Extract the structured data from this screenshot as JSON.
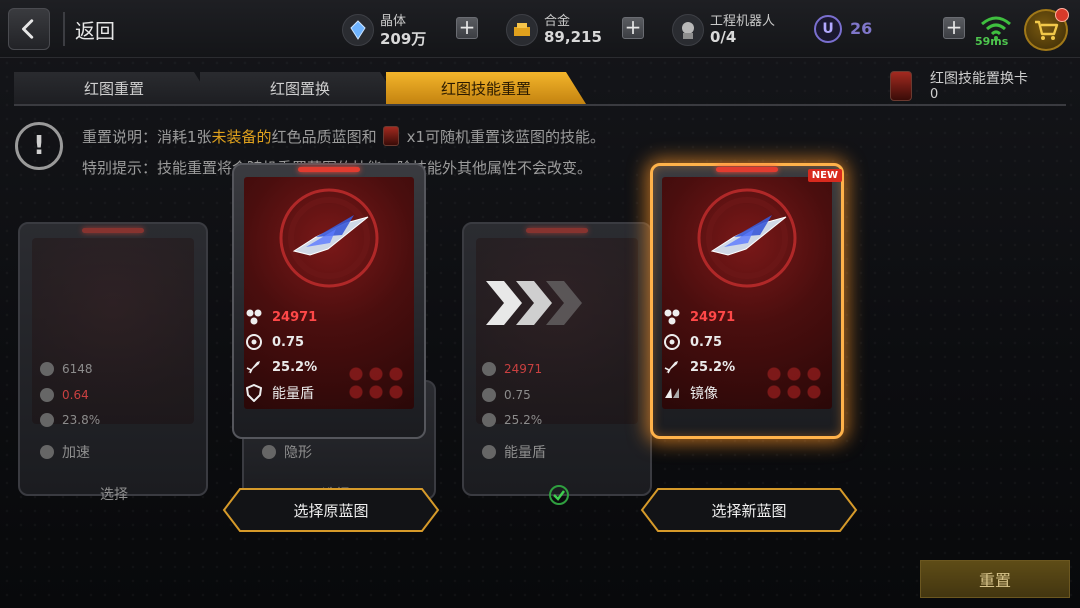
{
  "header": {
    "back_label": "返回",
    "resources": [
      {
        "name": "晶体",
        "value": "209万"
      },
      {
        "name": "合金",
        "value": "89,215"
      },
      {
        "name": "工程机器人",
        "value": "0/4"
      }
    ],
    "u_icon": "U",
    "u_value": "26",
    "ping": "59ms"
  },
  "tabs": [
    {
      "label": "红图重置"
    },
    {
      "label": "红图置换"
    },
    {
      "label": "红图技能重置"
    }
  ],
  "reset_card": {
    "title": "红图技能置换卡",
    "count": "0"
  },
  "notice": {
    "line1_prefix": "重置说明：消耗1张",
    "line1_highlight": "未装备的",
    "line1_mid": "红色品质蓝图和",
    "line1_suffix": "x1可随机重置该蓝图的技能。",
    "line2": "特别提示：技能重置将会随机重置蓝图的技能，除技能外其他属性不会改变。"
  },
  "left_slot": {
    "stats": [
      "6148",
      "0.64",
      "23.8%"
    ],
    "skill": "加速",
    "button": "选择"
  },
  "middle_slot": {
    "skill": "隐形",
    "button": "选择"
  },
  "right_slot": {
    "stats": [
      "24971",
      "0.75",
      "25.2%"
    ],
    "skill": "能量盾"
  },
  "original_card": {
    "power": "24971",
    "rate": "0.75",
    "crit": "25.2%",
    "skill": "能量盾"
  },
  "new_card": {
    "badge": "NEW",
    "power": "24971",
    "rate": "0.75",
    "crit": "25.2%",
    "skill": "镜像"
  },
  "buttons": {
    "select_original": "选择原蓝图",
    "select_new": "选择新蓝图",
    "reset": "重置"
  },
  "colors": {
    "accent": "#f3b52b",
    "stat_red": "#ff4848",
    "card_glow": "#ffb24a"
  }
}
